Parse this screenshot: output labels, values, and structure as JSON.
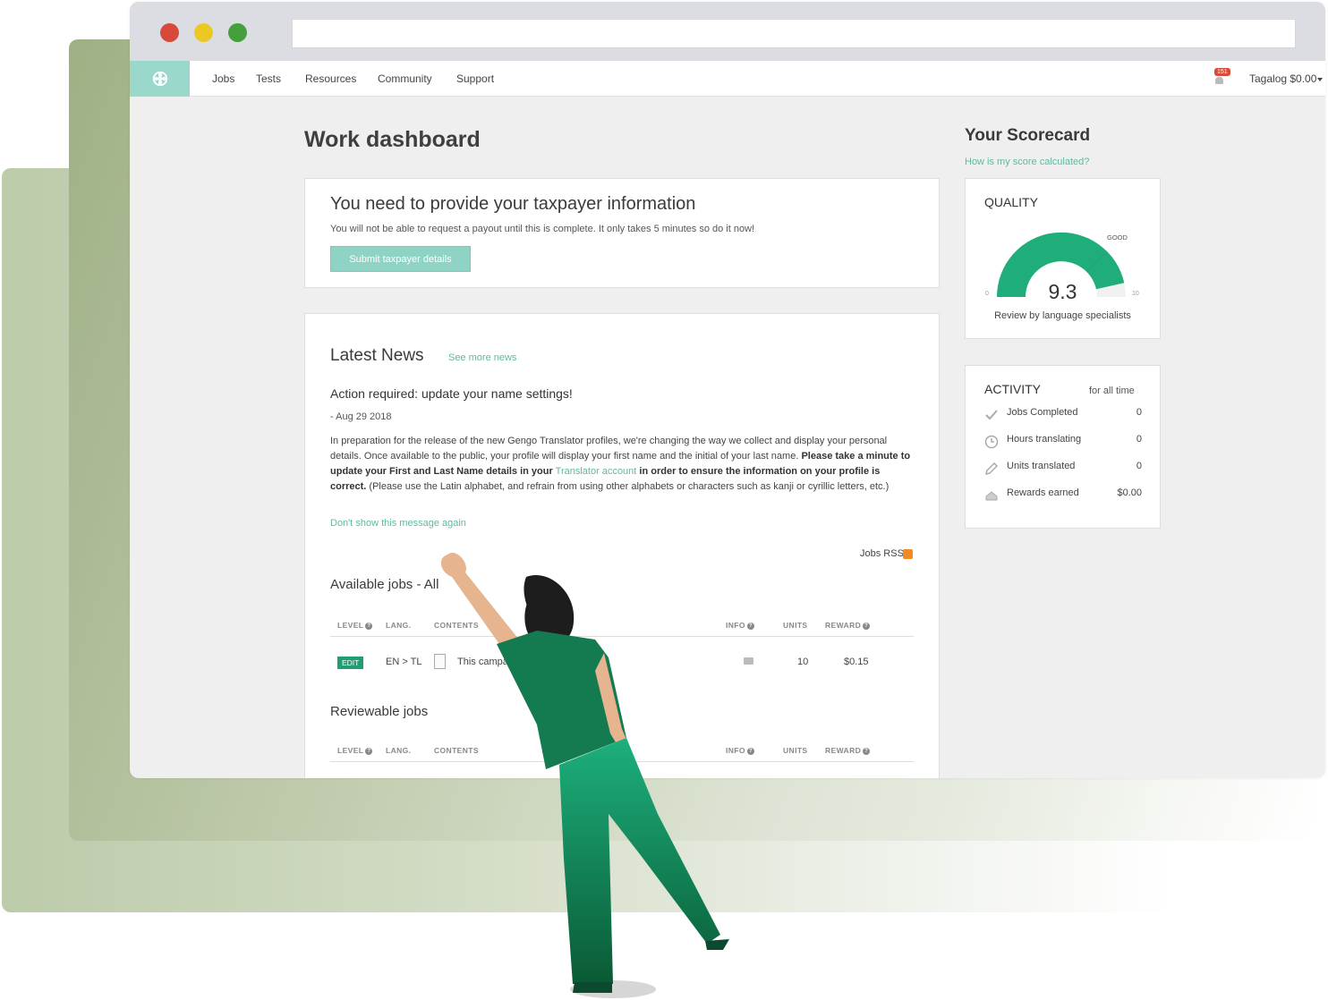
{
  "nav": {
    "items": [
      "Jobs",
      "Tests",
      "Resources",
      "Community",
      "Support"
    ],
    "notifications_count": "151",
    "account": "Tagalog $0.00"
  },
  "page_title": "Work dashboard",
  "taxpayer": {
    "title": "You need to provide your taxpayer information",
    "text": "You will not be able to request a payout until this is complete. It only takes 5 minutes so do it now!",
    "button": "Submit taxpayer details"
  },
  "news": {
    "title": "Latest News",
    "see_more": "See more news",
    "headline": "Action required: update your name settings!",
    "date": "- Aug 29 2018",
    "body_1": "In preparation for the release of the new Gengo Translator profiles, we're changing the way we collect and display your personal details. Once available to the public, your profile will display your first name and the initial of your last name.",
    "body_bold_1": "Please take a minute to update your First and Last Name details in your",
    "body_link": "Translator account",
    "body_bold_2": "in order to ensure the information on your profile is correct.",
    "body_2": "(Please use the Latin alphabet, and refrain from using other alphabets or characters such as kanji or cyrillic letters, etc.)",
    "dismiss": "Don't show this message again"
  },
  "jobs": {
    "rss": "Jobs RSS",
    "available_title": "Available jobs - All",
    "reviewable_title": "Reviewable jobs",
    "columns": [
      "LEVEL",
      "LANG.",
      "CONTENTS",
      "INFO",
      "UNITS",
      "REWARD"
    ],
    "rows": [
      {
        "level": "EDIT",
        "lang": "EN > TL",
        "contents": "This campa",
        "units": "10",
        "reward": "$0.15"
      }
    ]
  },
  "scorecard": {
    "title": "Your Scorecard",
    "link": "How is my score calculated?",
    "quality": {
      "heading": "QUALITY",
      "value": "9.3",
      "min": "0",
      "max": "10",
      "band_label": "GOOD",
      "subtitle": "Review by language specialists"
    },
    "activity": {
      "heading": "ACTIVITY",
      "period": "for all time",
      "rows": [
        {
          "icon": "check-icon",
          "label": "Jobs Completed",
          "value": "0"
        },
        {
          "icon": "clock-icon",
          "label": "Hours translating",
          "value": "0"
        },
        {
          "icon": "pencil-icon",
          "label": "Units translated",
          "value": "0"
        },
        {
          "icon": "piggy-bank-icon",
          "label": "Rewards earned",
          "value": "$0.00"
        }
      ]
    }
  },
  "colors": {
    "brand": "#9ad8cc",
    "accent": "#5fb8a2",
    "gauge": "#1fae7a",
    "badge": "#1f9e72"
  }
}
